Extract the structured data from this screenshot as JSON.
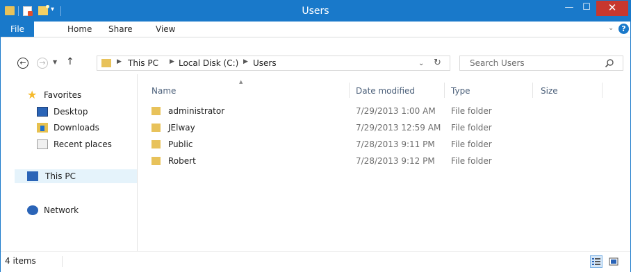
{
  "window": {
    "title": "Users",
    "min_label": "—",
    "max_label": "☐",
    "close_label": "✕"
  },
  "ribbon": {
    "tabs": [
      "File",
      "Home",
      "Share",
      "View"
    ]
  },
  "address": {
    "crumbs": [
      "This PC",
      "Local Disk (C:)",
      "Users"
    ],
    "search_placeholder": "Search Users"
  },
  "nav": {
    "favorites": "Favorites",
    "desktop": "Desktop",
    "downloads": "Downloads",
    "recent": "Recent places",
    "this_pc": "This PC",
    "network": "Network"
  },
  "columns": {
    "name": "Name",
    "date": "Date modified",
    "type": "Type",
    "size": "Size"
  },
  "rows": [
    {
      "name": "administrator",
      "date": "7/29/2013 1:00 AM",
      "type": "File folder"
    },
    {
      "name": "JElway",
      "date": "7/29/2013 12:59 AM",
      "type": "File folder"
    },
    {
      "name": "Public",
      "date": "7/28/2013 9:11 PM",
      "type": "File folder"
    },
    {
      "name": "Robert",
      "date": "7/28/2013 9:12 PM",
      "type": "File folder"
    }
  ],
  "status": {
    "items_count": "4 items"
  },
  "colors": {
    "title_bar": "#1979ca",
    "close_button": "#c7372e",
    "folder": "#e8c25a",
    "selected_nav": "#e5f3fb"
  }
}
